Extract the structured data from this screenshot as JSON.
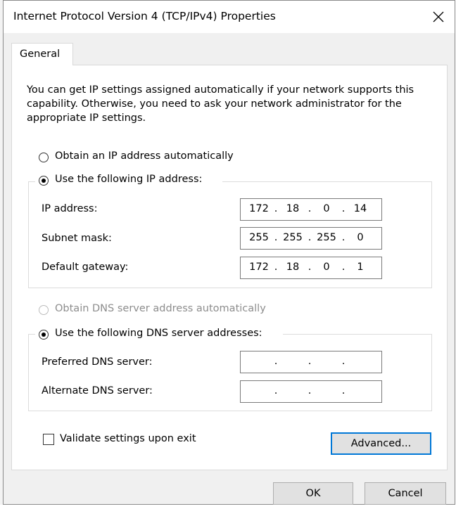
{
  "window": {
    "title": "Internet Protocol Version 4 (TCP/IPv4) Properties",
    "close_icon": "close-icon"
  },
  "tabs": [
    {
      "label": "General"
    }
  ],
  "intro_text": "You can get IP settings assigned automatically if your network supports this capability. Otherwise, you need to ask your network administrator for the appropriate IP settings.",
  "ip": {
    "auto_label": "Obtain an IP address automatically",
    "auto_selected": false,
    "manual_label": "Use the following IP address:",
    "manual_selected": true,
    "fields": [
      {
        "label": "IP address:",
        "octets": [
          "172",
          "18",
          "0",
          "14"
        ]
      },
      {
        "label": "Subnet mask:",
        "octets": [
          "255",
          "255",
          "255",
          "0"
        ]
      },
      {
        "label": "Default gateway:",
        "octets": [
          "172",
          "18",
          "0",
          "1"
        ]
      }
    ]
  },
  "dns": {
    "auto_label": "Obtain DNS server address automatically",
    "auto_selected": false,
    "auto_disabled": true,
    "manual_label": "Use the following DNS server addresses:",
    "manual_selected": true,
    "fields": [
      {
        "label": "Preferred DNS server:",
        "octets": [
          "",
          "",
          "",
          ""
        ]
      },
      {
        "label": "Alternate DNS server:",
        "octets": [
          "",
          "",
          "",
          ""
        ]
      }
    ]
  },
  "validate": {
    "label": "Validate settings upon exit",
    "checked": false
  },
  "buttons": {
    "advanced": "Advanced...",
    "ok": "OK",
    "cancel": "Cancel"
  }
}
